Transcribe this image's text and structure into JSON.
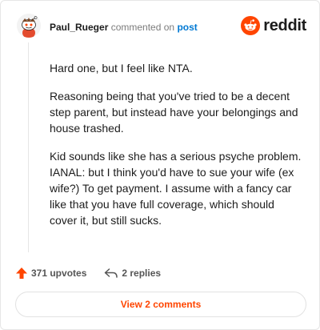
{
  "comment": {
    "username": "Paul_Rueger",
    "action_text": "commented on",
    "post_link": "post",
    "paragraphs": [
      "Hard one, but I feel like NTA.",
      "Reasoning being that you've tried to be a decent step parent, but instead have your belongings and house trashed.",
      "Kid sounds like she has a serious psyche problem. IANAL: but I think you'd have to sue your wife (ex wife?) To get payment. I assume with a fancy car like that you have full coverage, which should cover it, but still sucks."
    ]
  },
  "brand": {
    "wordmark": "reddit",
    "accent": "#ff4500"
  },
  "footer": {
    "upvotes": "371 upvotes",
    "replies": "2 replies",
    "view_button": "View 2 comments"
  },
  "icons": [
    "snoo-avatar-icon",
    "reddit-logo-icon",
    "upvote-arrow-icon",
    "reply-arrow-icon"
  ]
}
